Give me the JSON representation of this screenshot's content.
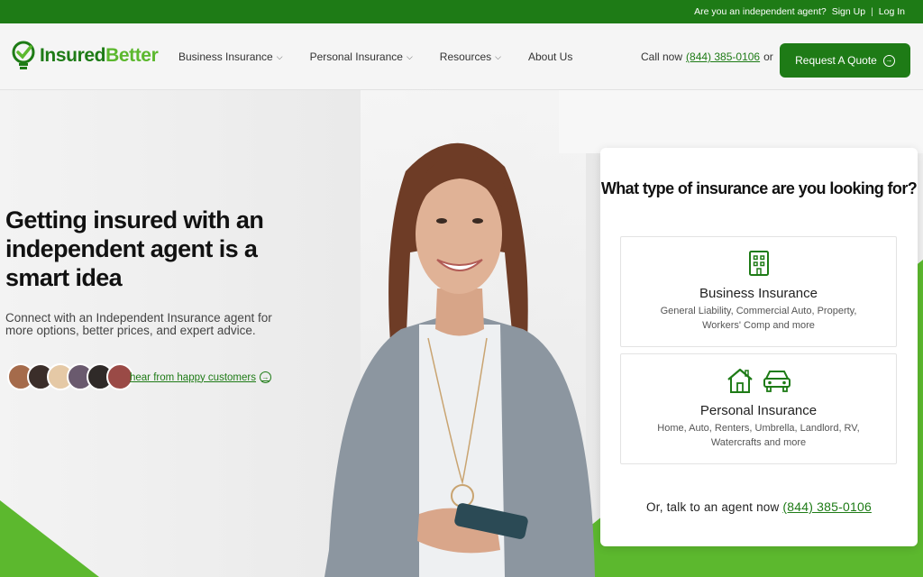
{
  "topbar": {
    "question": "Are you an independent agent?",
    "signup": "Sign Up",
    "separator": "|",
    "login": "Log In"
  },
  "brand": {
    "part1": "Insured",
    "part2": "Better",
    "primary_color": "#1e7b16",
    "accent_color": "#5cb82e"
  },
  "nav": {
    "items": [
      {
        "label": "Business Insurance",
        "has_dropdown": true
      },
      {
        "label": "Personal Insurance",
        "has_dropdown": true
      },
      {
        "label": "Resources",
        "has_dropdown": true
      },
      {
        "label": "About Us",
        "has_dropdown": false
      }
    ],
    "caret": "⌵"
  },
  "header": {
    "call_label": "Call now",
    "phone": "(844) 385-0106",
    "or": "or",
    "quote_button": "Request A Quote",
    "arrow": "→"
  },
  "hero": {
    "headline": "Getting insured with an independent agent is a smart idea",
    "subtext": "Connect with an Independent Insurance agent for more options, better prices, and expert advice.",
    "testimonials_link": "hear from happy customers"
  },
  "card": {
    "title": "What type of insurance are you looking for?",
    "options": [
      {
        "title": "Business Insurance",
        "description": "General Liability, Commercial Auto, Property, Workers' Comp and more",
        "icons": [
          "building-icon"
        ]
      },
      {
        "title": "Personal Insurance",
        "description": "Home, Auto, Renters, Umbrella, Landlord, RV, Watercrafts and more",
        "icons": [
          "house-icon",
          "car-icon"
        ]
      }
    ],
    "footer_text": "Or, talk to an agent now",
    "footer_phone": "(844) 385-0106"
  }
}
